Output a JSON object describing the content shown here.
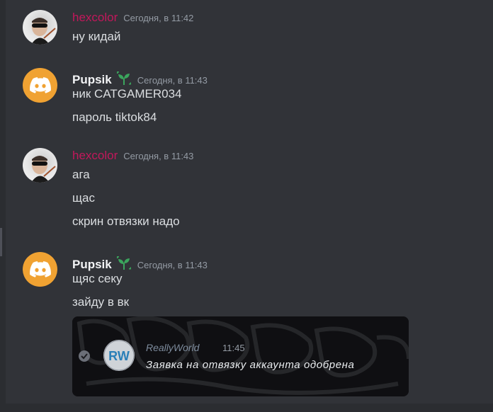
{
  "messages": [
    {
      "author": "hexcolor",
      "timestamp": "Сегодня, в 11:42",
      "lines": [
        "ну кидай"
      ]
    },
    {
      "author": "Pupsik",
      "timestamp": "Сегодня, в 11:43",
      "lines": [
        "ник CATGAMER034",
        "пароль tiktok84"
      ]
    },
    {
      "author": "hexcolor",
      "timestamp": "Сегодня, в 11:43",
      "lines": [
        "ага",
        "щас",
        "скрин отвязки надо"
      ]
    },
    {
      "author": "Pupsik",
      "timestamp": "Сегодня, в 11:43",
      "lines": [
        "щяс секу",
        "зайду в вк"
      ]
    }
  ],
  "attachment": {
    "sender": "ReallyWorld",
    "time": "11:45",
    "text": "Заявка на отвязку аккаунта одобрена",
    "logo_text": "RW"
  },
  "colors": {
    "background": "#313338",
    "hexcolor_name": "#c2185b",
    "pupsik_avatar": "#f0a232",
    "badge_green": "#3ba55d"
  },
  "icons": {
    "discord_avatar": "discord-logo-icon",
    "badge": "sprout-badge-icon",
    "verified": "check-circle-icon"
  }
}
